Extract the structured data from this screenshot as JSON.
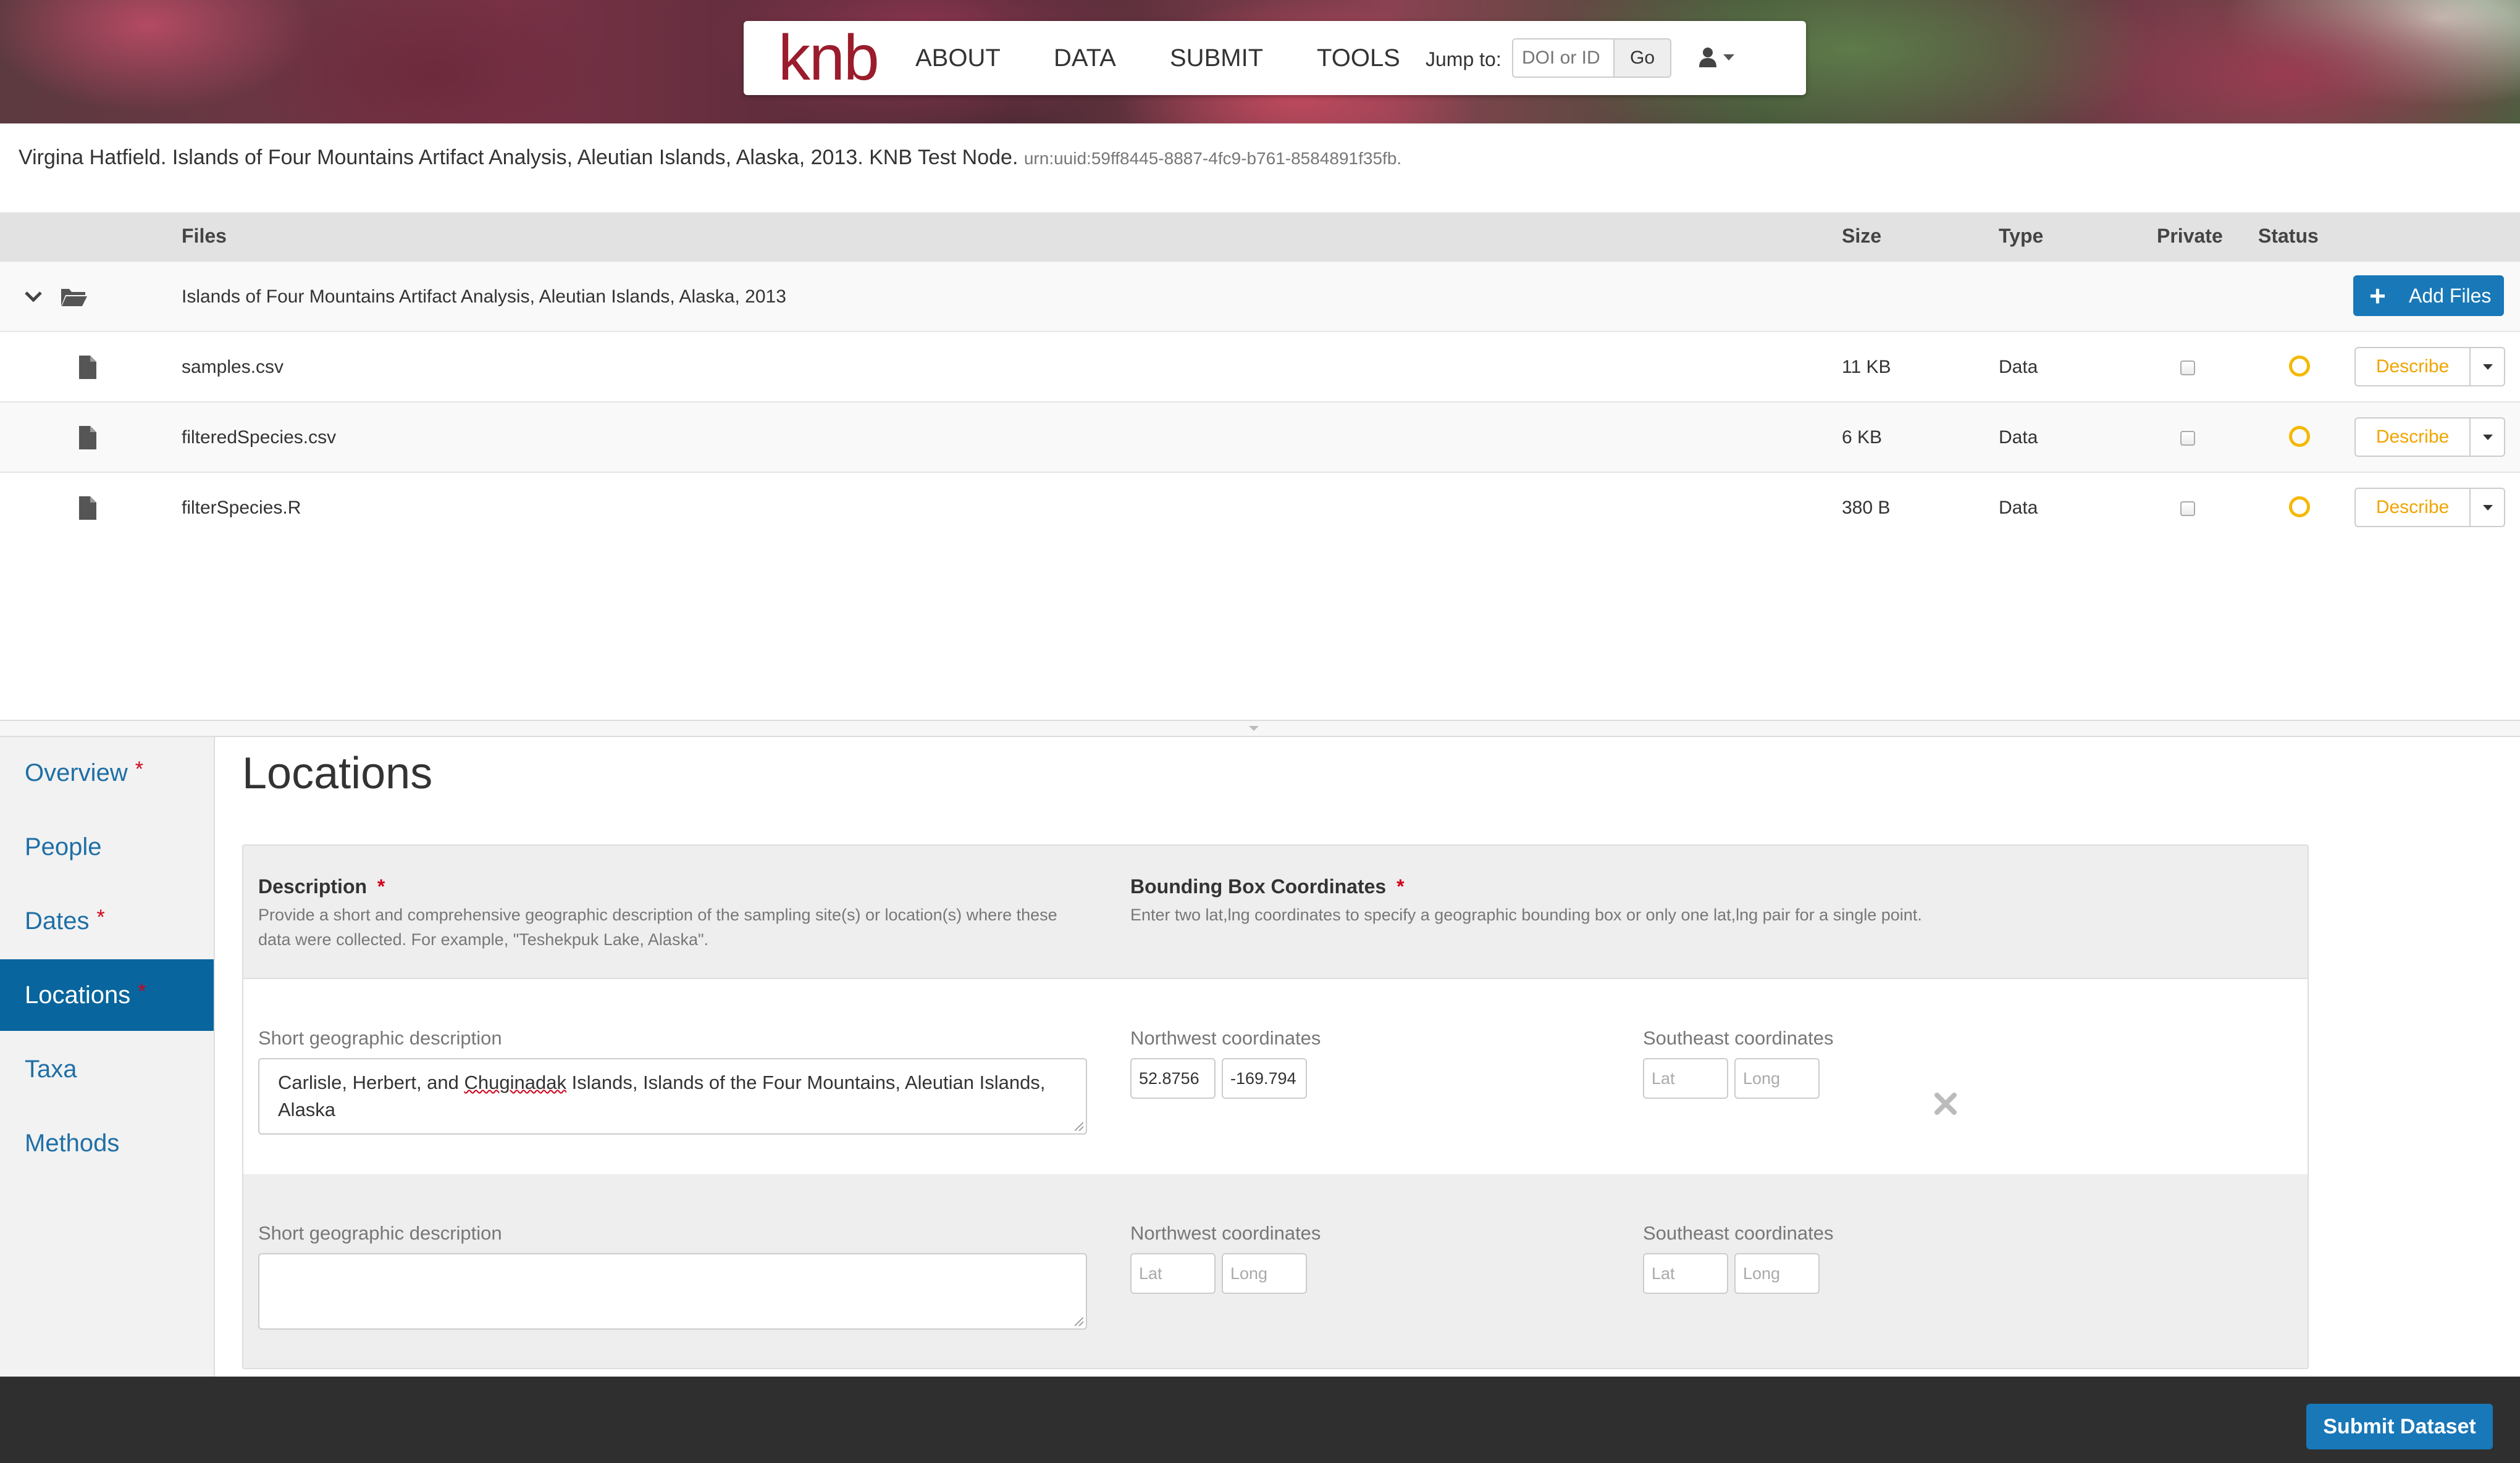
{
  "nav": {
    "logo": "knb",
    "links": [
      "ABOUT",
      "DATA",
      "SUBMIT",
      "TOOLS"
    ],
    "jump_label": "Jump to:",
    "jump_placeholder": "DOI or ID",
    "go_label": "Go"
  },
  "citation": {
    "text": "Virgina Hatfield. Islands of Four Mountains Artifact Analysis, Aleutian Islands, Alaska, 2013. KNB Test Node.",
    "urn": "urn:uuid:59ff8445-8887-4fc9-b761-8584891f35fb."
  },
  "files_table": {
    "headers": {
      "files": "Files",
      "size": "Size",
      "type": "Type",
      "private": "Private",
      "status": "Status"
    },
    "package_name": "Islands of Four Mountains Artifact Analysis, Aleutian Islands, Alaska, 2013",
    "add_files_label": "Add Files",
    "rows": [
      {
        "name": "samples.csv",
        "size": "11 KB",
        "type": "Data",
        "action": "Describe"
      },
      {
        "name": "filteredSpecies.csv",
        "size": "6 KB",
        "type": "Data",
        "action": "Describe"
      },
      {
        "name": "filterSpecies.R",
        "size": "380 B",
        "type": "Data",
        "action": "Describe"
      }
    ]
  },
  "sidebar": {
    "items": [
      {
        "label": "Overview",
        "required": "*"
      },
      {
        "label": "People",
        "required": ""
      },
      {
        "label": "Dates",
        "required": "*"
      },
      {
        "label": "Locations",
        "required": "*"
      },
      {
        "label": "Taxa",
        "required": ""
      },
      {
        "label": "Methods",
        "required": ""
      }
    ],
    "active": "Locations"
  },
  "locations": {
    "title": "Locations",
    "description_title": "Description",
    "description_help": [
      "Provide a short and comprehensive geographic description of the sampling site(s) or location(s) where these",
      "data were collected. For example, \"Teshekpuk Lake, Alaska\"."
    ],
    "bbox_title": "Bounding Box Coordinates",
    "bbox_help": "Enter two lat,lng coordinates to specify a geographic bounding box or only one lat,lng pair for a single point.",
    "required_mark": "*",
    "short_desc_label": "Short geographic description",
    "nw_label": "Northwest coordinates",
    "se_label": "Southeast coordinates",
    "lat_placeholder": "Lat",
    "long_placeholder": "Long",
    "entries": [
      {
        "description_parts": [
          "Carlisle, Herbert, and ",
          "Chuginadak",
          " Islands, Islands of the Four Mountains, Aleutian Islands,",
          "Alaska"
        ],
        "nw_lat": "52.8756",
        "nw_long": "-169.794",
        "se_lat": "",
        "se_long": ""
      },
      {
        "description_parts": [
          "",
          "",
          "",
          ""
        ],
        "nw_lat": "",
        "nw_long": "",
        "se_lat": "",
        "se_long": ""
      }
    ]
  },
  "footer": {
    "submit_label": "Submit Dataset"
  },
  "colors": {
    "brand": "#9b1c2c",
    "primary": "#1878b8",
    "active_nav": "#08659d",
    "status_pending": "#f5b800",
    "required": "#d0021b"
  }
}
